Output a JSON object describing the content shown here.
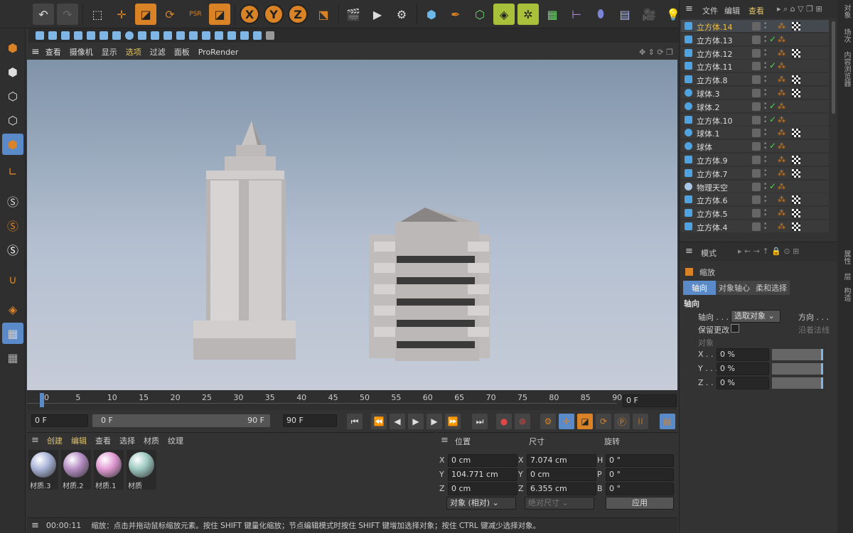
{
  "viewport_menu": [
    "查看",
    "摄像机",
    "显示",
    "选项",
    "过滤",
    "面板",
    "ProRender"
  ],
  "timeline": {
    "ticks": [
      "0",
      "5",
      "10",
      "15",
      "20",
      "25",
      "30",
      "35",
      "40",
      "45",
      "50",
      "55",
      "60",
      "65",
      "70",
      "75",
      "80",
      "85",
      "90"
    ],
    "current_frame": "0 F",
    "start_field": "0 F",
    "range_start": "0 F",
    "range_end": "90 F",
    "end_field": "90 F"
  },
  "materials": {
    "menu": [
      "创建",
      "编辑",
      "查看",
      "选择",
      "材质",
      "纹理"
    ],
    "items": [
      {
        "name": "材质.3",
        "color": "#a9b4d8"
      },
      {
        "name": "材质.2",
        "color": "#b68ec4"
      },
      {
        "name": "材质.1",
        "color": "#e19bd4"
      },
      {
        "name": "材质",
        "color": "#9ec9c1"
      }
    ]
  },
  "coords": {
    "headers": {
      "position": "位置",
      "size": "尺寸",
      "rotation": "旋转"
    },
    "rows": [
      {
        "axis": "X",
        "pos": "0 cm",
        "size_axis": "X",
        "size": "7.074 cm",
        "rot_axis": "H",
        "rot": "0 °"
      },
      {
        "axis": "Y",
        "pos": "104.771 cm",
        "size_axis": "Y",
        "size": "0 cm",
        "rot_axis": "P",
        "rot": "0 °"
      },
      {
        "axis": "Z",
        "pos": "0 cm",
        "size_axis": "Z",
        "size": "6.355 cm",
        "rot_axis": "B",
        "rot": "0 °"
      }
    ],
    "mode": "对象 (相对)",
    "size_mode": "绝对尺寸",
    "apply": "应用"
  },
  "status": {
    "time": "00:00:11",
    "message": "缩放：点击并拖动鼠标缩放元素。按住 SHIFT 键量化缩放；节点编辑模式时按住 SHIFT 键增加选择对象；按住 CTRL 键减少选择对象。"
  },
  "object_manager": {
    "menu": [
      "文件",
      "编辑",
      "查看"
    ],
    "objects": [
      {
        "name": "立方体.14",
        "type": "cube",
        "selected": true,
        "checked": false,
        "texture": true
      },
      {
        "name": "立方体.13",
        "type": "cube",
        "selected": false,
        "checked": true,
        "texture": false
      },
      {
        "name": "立方体.12",
        "type": "cube",
        "selected": false,
        "checked": false,
        "texture": true
      },
      {
        "name": "立方体.11",
        "type": "cube",
        "selected": false,
        "checked": true,
        "texture": false
      },
      {
        "name": "立方体.8",
        "type": "cube",
        "selected": false,
        "checked": false,
        "texture": true
      },
      {
        "name": "球体.3",
        "type": "sphere",
        "selected": false,
        "checked": false,
        "texture": true
      },
      {
        "name": "球体.2",
        "type": "sphere",
        "selected": false,
        "checked": true,
        "texture": false
      },
      {
        "name": "立方体.10",
        "type": "cube",
        "selected": false,
        "checked": true,
        "texture": false
      },
      {
        "name": "球体.1",
        "type": "sphere",
        "selected": false,
        "checked": false,
        "texture": true
      },
      {
        "name": "球体",
        "type": "sphere",
        "selected": false,
        "checked": true,
        "texture": false
      },
      {
        "name": "立方体.9",
        "type": "cube",
        "selected": false,
        "checked": false,
        "texture": true
      },
      {
        "name": "立方体.7",
        "type": "cube",
        "selected": false,
        "checked": false,
        "texture": true
      },
      {
        "name": "物理天空",
        "type": "sky",
        "selected": false,
        "checked": true,
        "texture": false
      },
      {
        "name": "立方体.6",
        "type": "cube",
        "selected": false,
        "checked": false,
        "texture": true
      },
      {
        "name": "立方体.5",
        "type": "cube",
        "selected": false,
        "checked": false,
        "texture": true
      },
      {
        "name": "立方体.4",
        "type": "cube",
        "selected": false,
        "checked": false,
        "texture": true
      }
    ]
  },
  "attributes": {
    "mode_label": "模式",
    "tool_name": "缩放",
    "tabs": [
      "轴向",
      "对象轴心",
      "柔和选择"
    ],
    "section": "轴向",
    "axis_label": "轴向 . . .",
    "axis_value": "选取对象",
    "direction_label": "方向 . . .",
    "keep_changes": "保留更改",
    "along_normal": "沿着法线",
    "object_label": "对象",
    "xyz": [
      {
        "axis": "X . . .",
        "value": "0 %"
      },
      {
        "axis": "Y . . .",
        "value": "0 %"
      },
      {
        "axis": "Z . . .",
        "value": "0 %"
      }
    ]
  },
  "right_strip": [
    "对象",
    "场次",
    "内容浏览器",
    "属性",
    "层",
    "构造"
  ]
}
